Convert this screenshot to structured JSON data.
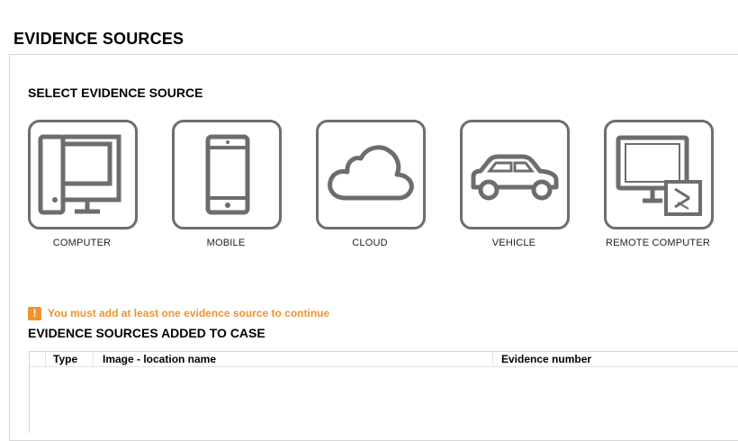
{
  "page": {
    "title": "EVIDENCE SOURCES"
  },
  "select_section": {
    "title": "SELECT EVIDENCE SOURCE"
  },
  "sources": [
    {
      "label": "COMPUTER",
      "icon": "desktop-computer-icon"
    },
    {
      "label": "MOBILE",
      "icon": "mobile-phone-icon"
    },
    {
      "label": "CLOUD",
      "icon": "cloud-icon"
    },
    {
      "label": "VEHICLE",
      "icon": "car-icon"
    },
    {
      "label": "REMOTE COMPUTER",
      "icon": "remote-computer-icon"
    }
  ],
  "warning": {
    "icon": "!",
    "text": "You must add at least one evidence source to continue",
    "color": "#f0932b"
  },
  "added_section": {
    "title": "EVIDENCE SOURCES ADDED TO CASE"
  },
  "table": {
    "columns": [
      "Type",
      "Image - location name",
      "Evidence number"
    ],
    "rows": []
  },
  "colors": {
    "icon_stroke": "#6d6d6d",
    "border": "#d6d6d6"
  }
}
